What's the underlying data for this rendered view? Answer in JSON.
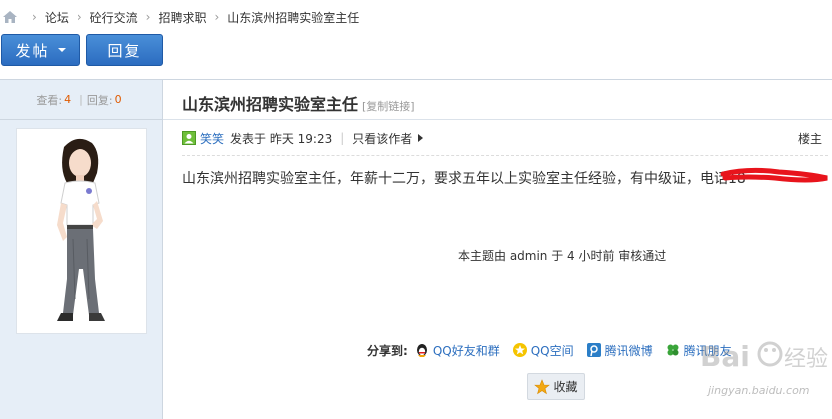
{
  "breadcrumb": {
    "items": [
      "论坛",
      "砼行交流",
      "招聘求职"
    ],
    "current": "山东滨州招聘实验室主任"
  },
  "toolbar": {
    "post_label": "发帖",
    "reply_label": "回复"
  },
  "stats": {
    "views_label": "查看:",
    "views": "4",
    "replies_label": "回复:",
    "replies": "0"
  },
  "thread": {
    "title": "山东滨州招聘实验室主任",
    "copy_link": "[复制链接]"
  },
  "post": {
    "author": "笑笑",
    "posted_at": "发表于 昨天 19:23",
    "only_author": "只看该作者",
    "floor": "楼主",
    "body": "山东滨州招聘实验室主任，年薪十二万，要求五年以上实验室主任经验，有中级证，电话18"
  },
  "moderation": {
    "note": "本主题由 admin 于 4 小时前 审核通过"
  },
  "share": {
    "label": "分享到:",
    "items": [
      "QQ好友和群",
      "QQ空间",
      "腾讯微博",
      "腾讯朋友"
    ]
  },
  "favorite": {
    "label": "收藏"
  },
  "watermark": {
    "brand": "Bai",
    "text": "经验",
    "url": "jingyan.baidu.com"
  },
  "colors": {
    "accent_blue": "#2c6cc0",
    "link_blue": "#2d6fbf",
    "count_orange": "#e05a00",
    "sidebar_bg": "#e6eef7",
    "redaction_red": "#e8141c"
  }
}
